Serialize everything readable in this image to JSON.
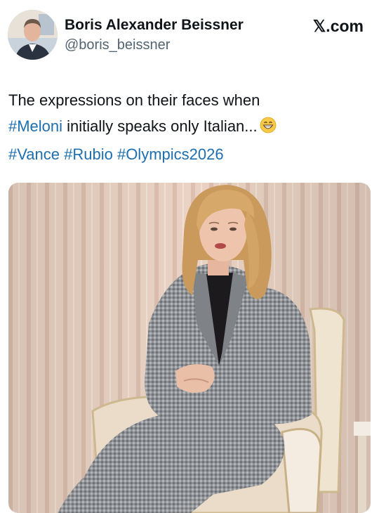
{
  "author": {
    "display_name": "Boris Alexander Beissner",
    "handle": "@boris_beissner"
  },
  "brand": "𝕏.com",
  "tweet": {
    "line1": "The expressions on their faces when",
    "line2_tag": "#Meloni",
    "line2_text": " initially speaks only Italian...",
    "emoji": "grinning-face",
    "hashtags": [
      "#Vance",
      "#Rubio",
      "#Olympics2026"
    ]
  },
  "colors": {
    "link": "#1d6fb0",
    "text": "#0f1419",
    "secondary": "#536471",
    "wall": "#e6cfc0"
  }
}
